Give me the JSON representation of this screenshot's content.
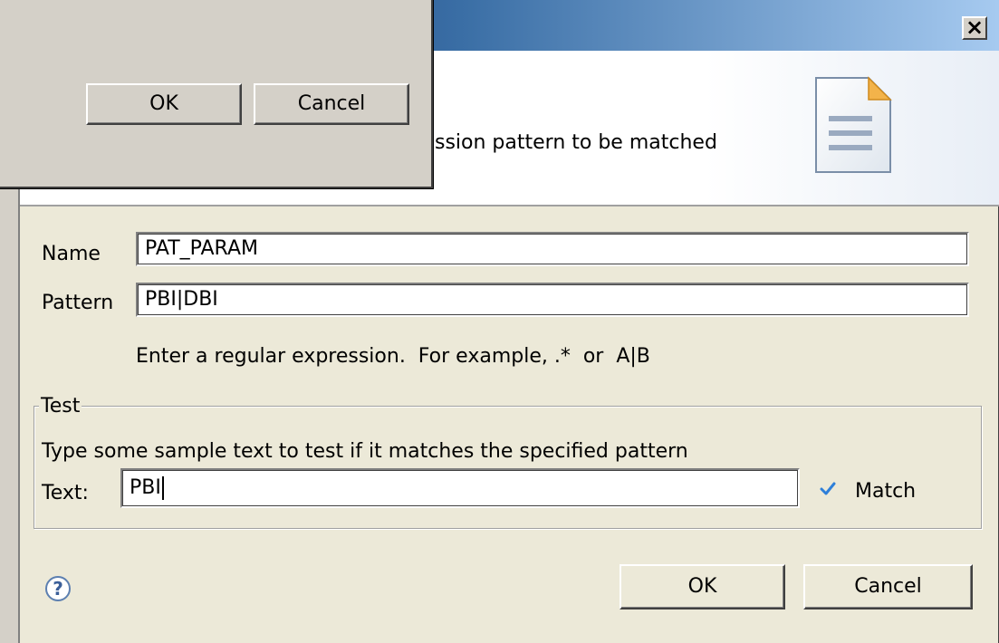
{
  "dialog": {
    "banner_message": "ssion pattern to be matched",
    "close_glyph": "×"
  },
  "form": {
    "name_label": "Name",
    "name_value": "PAT_PARAM",
    "pattern_label": "Pattern",
    "pattern_value": "PBI|DBI",
    "hint": "Enter a regular expression.  For example, .*  or  A|B"
  },
  "test": {
    "legend": "Test",
    "description": "Type some sample text to test if it matches the specified pattern",
    "text_label": "Text:",
    "text_value": "PBI",
    "match_label": "Match"
  },
  "buttons": {
    "ok": "OK",
    "cancel": "Cancel",
    "help_glyph": "?"
  },
  "small_dialog": {
    "ok": "OK",
    "cancel": "Cancel"
  },
  "colors": {
    "check": "#2e7fd9",
    "titlebar_start": "#0a246a",
    "titlebar_end": "#a6caf0"
  },
  "icons": [
    "document-icon",
    "check-icon",
    "help-icon",
    "close-icon"
  ]
}
